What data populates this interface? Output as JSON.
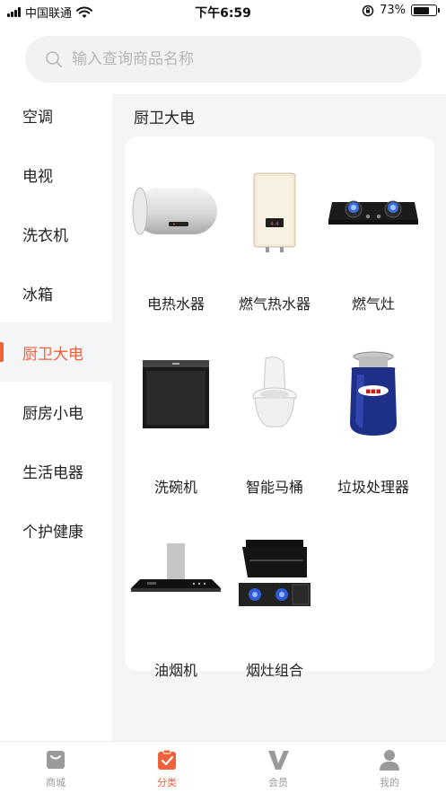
{
  "status_bar": {
    "carrier": "中国联通",
    "time": "下午6:59",
    "battery_percent_text": "73%",
    "battery_level": 0.73
  },
  "search": {
    "placeholder": "输入查询商品名称",
    "value": ""
  },
  "sidebar": {
    "items": [
      {
        "label": "空调",
        "active": false
      },
      {
        "label": "电视",
        "active": false
      },
      {
        "label": "洗衣机",
        "active": false
      },
      {
        "label": "冰箱",
        "active": false
      },
      {
        "label": "厨卫大电",
        "active": true
      },
      {
        "label": "厨房小电",
        "active": false
      },
      {
        "label": "生活电器",
        "active": false
      },
      {
        "label": "个护健康",
        "active": false
      }
    ]
  },
  "main": {
    "section_title": "厨卫大电",
    "products": [
      {
        "name": "电热水器",
        "icon": "electric-water-heater"
      },
      {
        "name": "燃气热水器",
        "icon": "gas-water-heater"
      },
      {
        "name": "燃气灶",
        "icon": "gas-stove"
      },
      {
        "name": "洗碗机",
        "icon": "dishwasher"
      },
      {
        "name": "智能马桶",
        "icon": "smart-toilet"
      },
      {
        "name": "垃圾处理器",
        "icon": "garbage-disposer"
      },
      {
        "name": "油烟机",
        "icon": "range-hood"
      },
      {
        "name": "烟灶组合",
        "icon": "hood-stove-combo"
      }
    ]
  },
  "tab_bar": {
    "tabs": [
      {
        "label": "商城",
        "icon": "shopping-bag-icon",
        "active": false
      },
      {
        "label": "分类",
        "icon": "clipboard-check-icon",
        "active": true
      },
      {
        "label": "会员",
        "icon": "member-v-icon",
        "active": false
      },
      {
        "label": "我的",
        "icon": "person-icon",
        "active": false
      }
    ]
  },
  "colors": {
    "accent": "#f0603a",
    "panel_bg": "#f4f5f7",
    "inactive_tab": "#9a9a9a"
  }
}
